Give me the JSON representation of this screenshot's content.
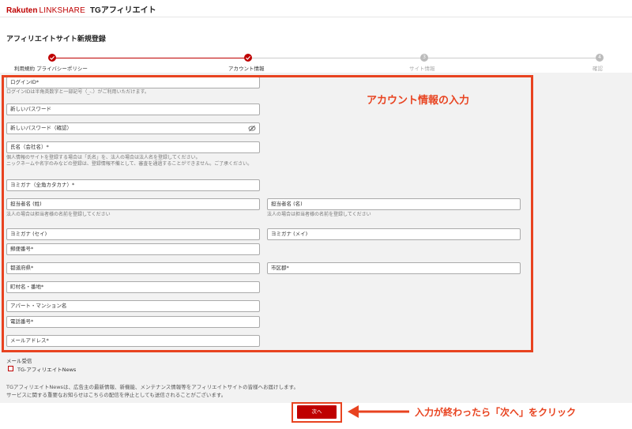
{
  "header": {
    "brand": "Rakuten",
    "brand_sub": "LINKSHARE",
    "product": "TGアフィリエイト"
  },
  "page_title": "アフィリエイトサイト新規登録",
  "steps": [
    {
      "label": "利用規約 プライバシーポリシー",
      "number": "",
      "status": "done"
    },
    {
      "label": "アカウント情報",
      "number": "",
      "status": "done"
    },
    {
      "label": "サイト情報",
      "number": "3",
      "status": "todo"
    },
    {
      "label": "確認",
      "number": "4",
      "status": "todo"
    }
  ],
  "annotation": {
    "box_title": "アカウント情報の入力",
    "next_instruction": "入力が終わったら「次へ」をクリック"
  },
  "fields": {
    "login_id": {
      "label": "ログインID*",
      "hint": "ログインIDは半角英数字と一部記号（_-.）がご利用いただけます。"
    },
    "new_password": {
      "label": "新しいパスワード"
    },
    "new_password_confirm": {
      "label": "新しいパスワード（確認）"
    },
    "name_company": {
      "label": "氏名（会社名）*",
      "hint1": "個人情報のサイトを登録する場合は「氏名」を、法人の場合は法人名を登録してください。",
      "hint2": "ニックネームや名字のみなどの登録は、登録情報不備として、審査を通過することができません。ご了承ください。"
    },
    "kana": {
      "label": "ヨミガナ（全角カタカナ）*"
    },
    "contact_last": {
      "label": "担当者名 (姓)",
      "hint": "法人の場合は担当者様の名前を登録してください"
    },
    "contact_first": {
      "label": "担当者名 (名)",
      "hint": "法人の場合は担当者様の名前を登録してください"
    },
    "kana_sei": {
      "label": "ヨミガナ (セイ)"
    },
    "kana_mei": {
      "label": "ヨミガナ (メイ)"
    },
    "postal_code": {
      "label": "郵便番号*"
    },
    "prefecture": {
      "label": "都道府県*"
    },
    "city": {
      "label": "市区郡*"
    },
    "town": {
      "label": "町村名・番地*"
    },
    "building": {
      "label": "アパート・マンション名"
    },
    "phone": {
      "label": "電話番号*"
    },
    "email": {
      "label": "メールアドレス*"
    }
  },
  "mail": {
    "section_label": "メール受信",
    "checkbox_label": "TG-アフィリエイトNews",
    "desc_line1": "TGアフィリエイトNewsは、広告主の最新情報、新機能、メンテナンス情報等をアフィリエイトサイトの皆様へお届けします。",
    "desc_line2": "サービスに関する重要なお知らせはこちらの配信を停止としても送信されることがございます。"
  },
  "next_button": "次へ",
  "colors": {
    "brand_red": "#bf0000",
    "annotation_orange": "#e84320"
  }
}
